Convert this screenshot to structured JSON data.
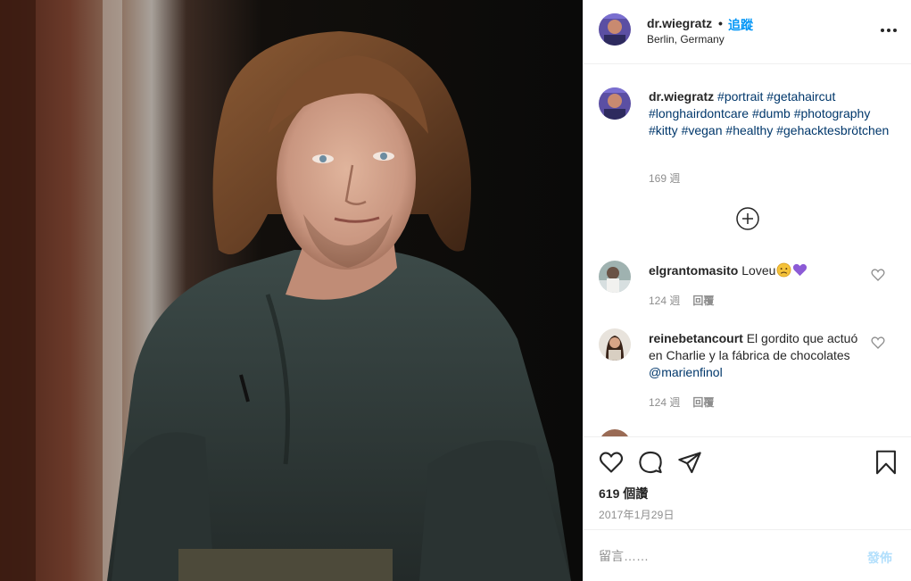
{
  "post": {
    "username": "dr.wiegratz",
    "separator": "•",
    "follow_label": "追蹤",
    "location": "Berlin, Germany",
    "image_alt": "Portrait of a man with shoulder-length wavy hair in a dark grey shirt"
  },
  "caption": {
    "username": "dr.wiegratz",
    "hashtags": [
      "#portrait",
      "#getahaircut",
      "#longhairdontcare",
      "#dumb",
      "#photography",
      "#kitty",
      "#vegan",
      "#healthy",
      "#gehacktesbrötchen"
    ],
    "time": "169 週"
  },
  "comments": [
    {
      "username": "elgrantomasito",
      "text": "Loveu",
      "emoji": [
        "sad-face-emoji",
        "purple-heart-emoji"
      ],
      "time": "124 週",
      "reply_label": "回覆"
    },
    {
      "username": "reinebetancourt",
      "text": "El gordito que actuó en Charlie y la fábrica de chocolates",
      "mention": "@marienfinol",
      "time": "124 週",
      "reply_label": "回覆"
    }
  ],
  "icons": {
    "more": "more-options-icon",
    "load_more": "plus-circle-icon",
    "like": "heart-icon",
    "comment": "comment-icon",
    "share": "share-icon",
    "save": "bookmark-icon"
  },
  "likes": "619 個讚",
  "date": "2017年1月29日",
  "comment_input": {
    "placeholder": "留言……",
    "value": ""
  },
  "post_button_label": "發佈",
  "colors": {
    "link": "#0095f6",
    "hashtag": "#00376b",
    "muted": "#8e8e8e",
    "post_disabled": "#b2dffc",
    "emoji_heart": "#8c5bd6"
  }
}
